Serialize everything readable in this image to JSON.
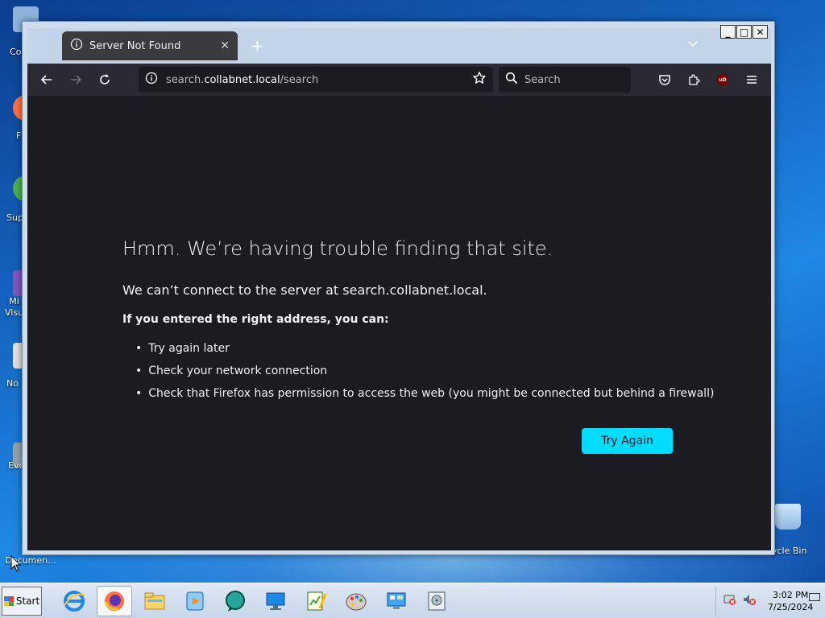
{
  "desktop": {
    "icons": [
      {
        "label": "Co"
      },
      {
        "label": "F"
      },
      {
        "label": "Sup"
      },
      {
        "label": "Mi\nVisu"
      },
      {
        "label": "No"
      },
      {
        "label": "Eve"
      },
      {
        "label": "Na\nDocumen..."
      },
      {
        "label": "ycle Bin"
      }
    ]
  },
  "window": {
    "controls": {
      "minimize": "_",
      "maximize": "□",
      "close": "✕"
    }
  },
  "browser": {
    "tab": {
      "title": "Server Not Found",
      "close": "✕"
    },
    "new_tab": "+",
    "url": {
      "prefix": "search.",
      "host": "collabnet.local",
      "path": "/search"
    },
    "search_placeholder": "Search"
  },
  "error_page": {
    "title": "Hmm. We’re having trouble finding that site.",
    "subtitle": "We can’t connect to the server at search.collabnet.local.",
    "lead": "If you entered the right address, you can:",
    "suggestions": [
      "Try again later",
      "Check your network connection",
      "Check that Firefox has permission to access the web (you might be connected but behind a firewall)"
    ],
    "button": "Try Again",
    "accent": "#00ddff"
  },
  "taskbar": {
    "start_label": "Start",
    "apps": [
      "internet-explorer",
      "firefox",
      "file-explorer",
      "media-player",
      "chat-app",
      "remote-desktop",
      "notepad-chart",
      "paint",
      "control-panel",
      "disk-utility"
    ],
    "clock": {
      "time": "3:02 PM",
      "date": "7/25/2024"
    }
  }
}
